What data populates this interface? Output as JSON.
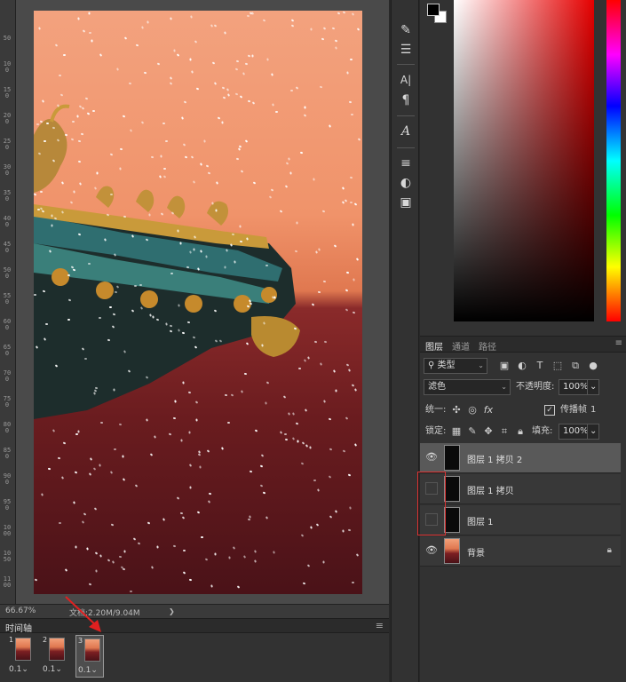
{
  "ruler": {
    "ticks": [
      "50",
      "100",
      "150",
      "200",
      "250",
      "300",
      "350",
      "400",
      "450",
      "500",
      "550",
      "600",
      "650",
      "700",
      "750",
      "800",
      "850",
      "900",
      "950",
      "1000",
      "1050",
      "1100"
    ]
  },
  "status": {
    "zoom": "66.67%",
    "doc_info": "文档:2.20M/9.04M",
    "arrow": "❯"
  },
  "tools": [
    "brush-tool-icon",
    "adjust-tool-icon",
    "character-tool-icon",
    "paragraph-tool-icon",
    "glyph-tool-icon",
    "properties-icon",
    "adjustments-icon",
    "libraries-icon"
  ],
  "color": {
    "foreground": "#000000",
    "background": "#ffffff"
  },
  "layers_panel": {
    "tabs": [
      "图层",
      "通道",
      "路径"
    ],
    "kind_filter": "类型",
    "blend_mode": "滤色",
    "opacity_label": "不透明度:",
    "opacity_value": "100%",
    "unify_label": "统一:",
    "propagate_label": "传播帧",
    "propagate_value": "1",
    "lock_label": "锁定:",
    "fill_label": "填充:",
    "fill_value": "100%",
    "layers": [
      {
        "name": "图层 1 拷贝 2",
        "visible": true,
        "selected": true
      },
      {
        "name": "图层 1 拷贝",
        "visible": false,
        "selected": false
      },
      {
        "name": "图层 1",
        "visible": false,
        "selected": false
      },
      {
        "name": "背景",
        "visible": true,
        "selected": false,
        "locked": true
      }
    ]
  },
  "timeline": {
    "title": "时间轴",
    "frames": [
      {
        "number": "1",
        "delay": "0.1"
      },
      {
        "number": "2",
        "delay": "0.1"
      },
      {
        "number": "3",
        "delay": "0.1"
      }
    ]
  }
}
